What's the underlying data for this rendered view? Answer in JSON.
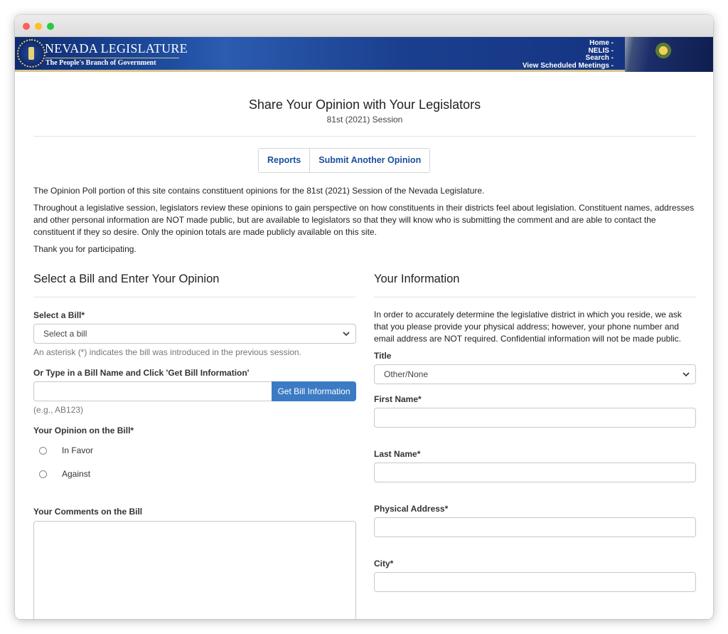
{
  "header": {
    "brand_title": "NEVADA LEGISLATURE",
    "brand_subtitle": "The People's Branch of Government",
    "nav": [
      "Home -",
      "NELIS -",
      "Search -",
      "View Scheduled Meetings -"
    ]
  },
  "page": {
    "title": "Share Your Opinion with Your Legislators",
    "subtitle": "81st (2021) Session",
    "buttons": [
      "Reports",
      "Submit Another Opinion"
    ],
    "intro": "The Opinion Poll portion of this site contains constituent opinions for the 81st (2021) Session of the Nevada Legislature.",
    "body": "Throughout a legislative session, legislators review these opinions to gain perspective on how constituents in their districts feel about legislation. Constituent names, addresses and other personal information are NOT made public, but are available to legislators so that they will know who is submitting the comment and are able to contact the constituent if they so desire. Only the opinion totals are made publicly available on this site.",
    "thanks": "Thank you for participating."
  },
  "left": {
    "heading": "Select a Bill and Enter Your Opinion",
    "select_bill_label": "Select a Bill*",
    "select_bill_value": "Select a bill",
    "asterisk_hint": "An asterisk (*) indicates the bill was introduced in the previous session.",
    "type_bill_label": "Or Type in a Bill Name and Click 'Get Bill Information'",
    "get_bill_button": "Get Bill Information",
    "example_hint": "(e.g., AB123)",
    "opinion_label": "Your Opinion on the Bill*",
    "opinion_options": [
      "In Favor",
      "Against"
    ],
    "comments_label": "Your Comments on the Bill"
  },
  "right": {
    "heading": "Your Information",
    "info_text": "In order to accurately determine the legislative district in which you reside, we ask that you please provide your physical address; however, your phone number and email address are NOT required. Confidential information will not be made public.",
    "title_label": "Title",
    "title_value": "Other/None",
    "first_name_label": "First Name*",
    "last_name_label": "Last Name*",
    "address_label": "Physical Address*",
    "city_label": "City*"
  }
}
